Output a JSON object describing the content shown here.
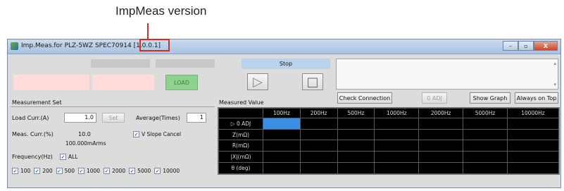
{
  "annotation": {
    "label": "ImpMeas version"
  },
  "window": {
    "title": "Imp.Meas.for PLZ-5WZ SPEC70914",
    "version": "[1.0.0.1]",
    "buttons": {
      "minimize": "–",
      "maximize": "▫",
      "close": "X"
    }
  },
  "toolbar": {
    "load_label": "LOAD",
    "stop_label": "Stop",
    "play_glyph": "▷",
    "stop_glyph": "□",
    "scroll_up": "▴",
    "scroll_down": "▾"
  },
  "measurement_set": {
    "heading": "Measurement Set",
    "load_curr_label": "Load Curr.(A)",
    "load_curr_value": "1.0",
    "set_label": "Set",
    "average_label": "Average(Times)",
    "average_value": "1",
    "meas_curr_label": "Meas. Curr.(%)",
    "meas_curr_value": "10.0",
    "meas_curr_sub": "100.000mArms",
    "v_slope_label": "V Slope Cancel",
    "frequency_label": "Frequency(Hz)",
    "all_label": "ALL",
    "frequencies": [
      "100",
      "200",
      "500",
      "1000",
      "2000",
      "5000",
      "10000"
    ]
  },
  "measured": {
    "heading": "Measured Value",
    "check_connection": "Check Connection",
    "zero_adj": "0 ADJ",
    "show_graph": "Show Graph",
    "always_on_top": "Always on Top",
    "columns": [
      "",
      "100Hz",
      "200Hz",
      "500Hz",
      "1000Hz",
      "2000Hz",
      "5000Hz",
      "10000Hz"
    ],
    "rows": [
      "0 ADJ",
      "Z(mΩ)",
      "R(mΩ)",
      "|X|(mΩ)",
      "θ (deg)"
    ],
    "row_marker": "▷"
  }
}
